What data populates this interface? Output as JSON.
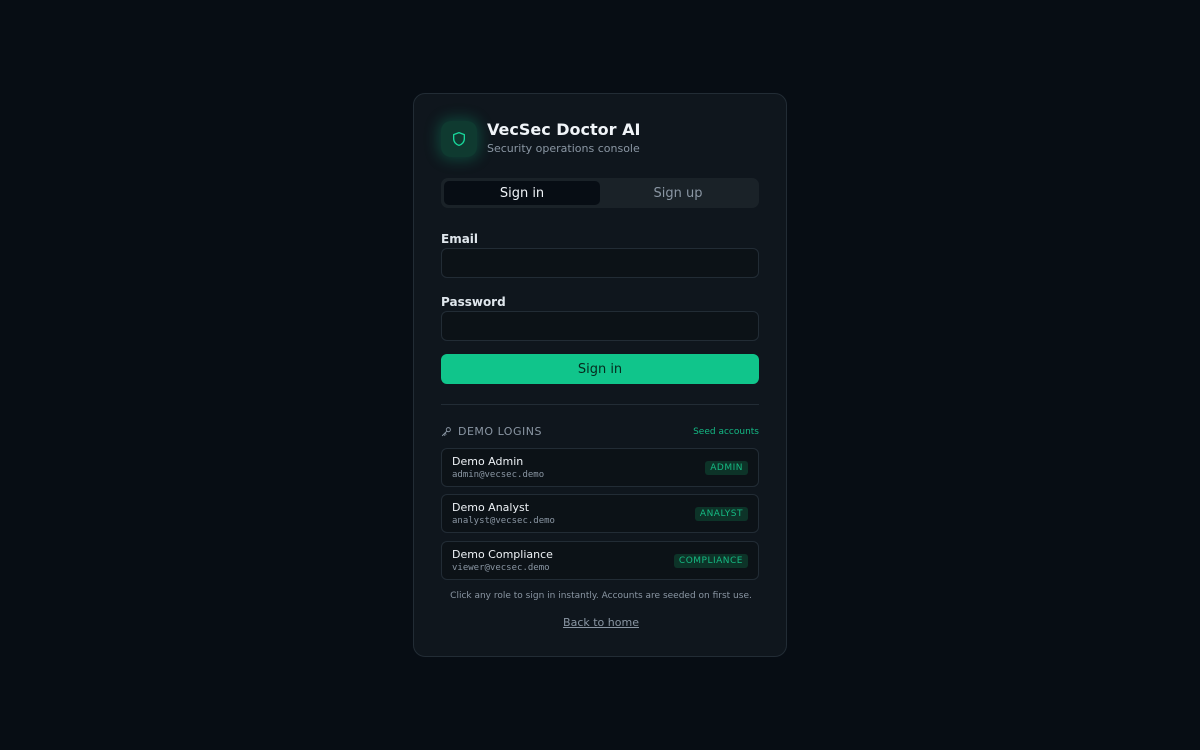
{
  "brand": {
    "icon": "shield-icon",
    "title": "VecSec Doctor AI",
    "subtitle": "Security operations console",
    "accent": "#10c58b"
  },
  "tabs": [
    {
      "label": "Sign in",
      "active": true
    },
    {
      "label": "Sign up",
      "active": false
    }
  ],
  "form": {
    "email_label": "Email",
    "email_value": "",
    "password_label": "Password",
    "password_value": "",
    "submit_label": "Sign in"
  },
  "demo": {
    "icon": "key-icon",
    "title": "DEMO LOGINS",
    "seed_label": "Seed accounts",
    "accounts": [
      {
        "name": "Demo Admin",
        "email": "admin@vecsec.demo",
        "role": "ADMIN"
      },
      {
        "name": "Demo Analyst",
        "email": "analyst@vecsec.demo",
        "role": "ANALYST"
      },
      {
        "name": "Demo Compliance",
        "email": "viewer@vecsec.demo",
        "role": "COMPLIANCE"
      }
    ],
    "hint": "Click any role to sign in instantly. Accounts are seeded on first use."
  },
  "footer": {
    "back_label": "Back to home"
  }
}
